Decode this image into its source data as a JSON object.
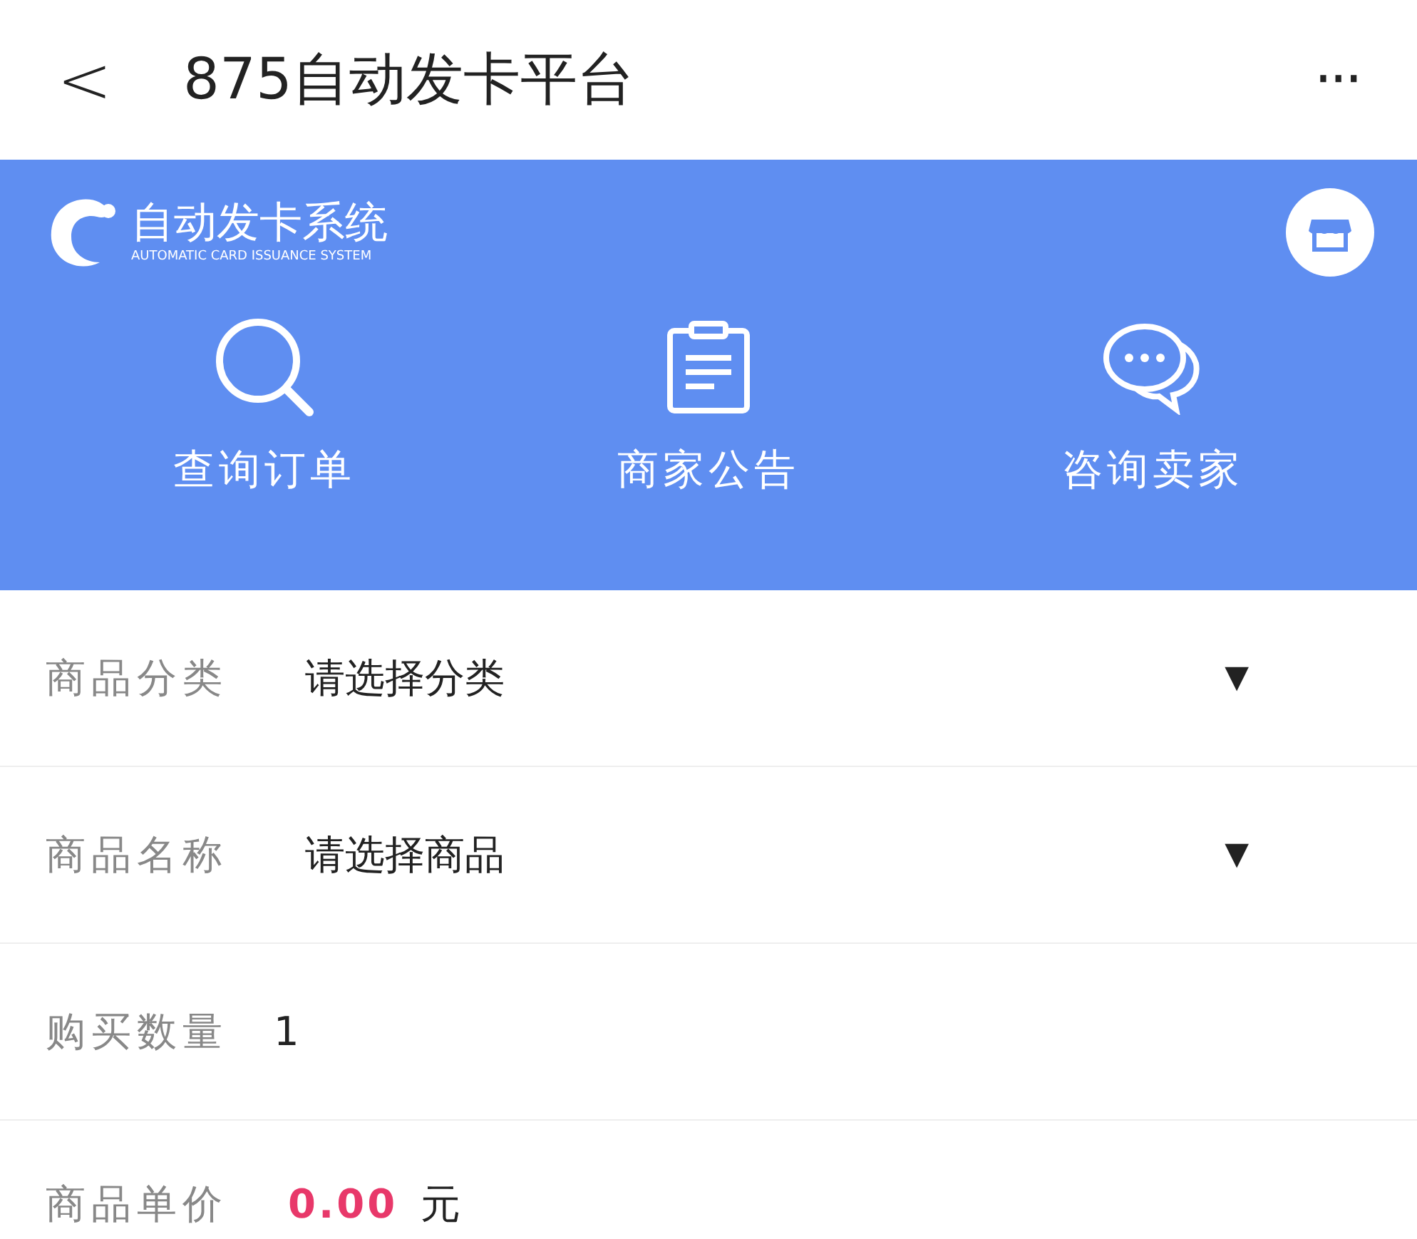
{
  "header": {
    "back": "<",
    "title": "875自动发卡平台",
    "more": "···"
  },
  "banner": {
    "logo_title": "自动发卡系统",
    "logo_subtitle": "AUTOMATIC CARD ISSUANCE SYSTEM",
    "actions": [
      {
        "kind": "search",
        "label": "查询订单"
      },
      {
        "kind": "notice",
        "label": "商家公告"
      },
      {
        "kind": "chat",
        "label": "咨询卖家"
      }
    ]
  },
  "form": [
    {
      "kind": "select",
      "label": "商品分类",
      "value": "请选择分类",
      "caret": "▼"
    },
    {
      "kind": "select",
      "label": "商品名称",
      "value": "请选择商品",
      "caret": "▼"
    },
    {
      "kind": "input",
      "label": "购买数量",
      "value": "1"
    },
    {
      "kind": "price",
      "label": "商品单价",
      "value": "0.00",
      "unit": "元"
    }
  ]
}
